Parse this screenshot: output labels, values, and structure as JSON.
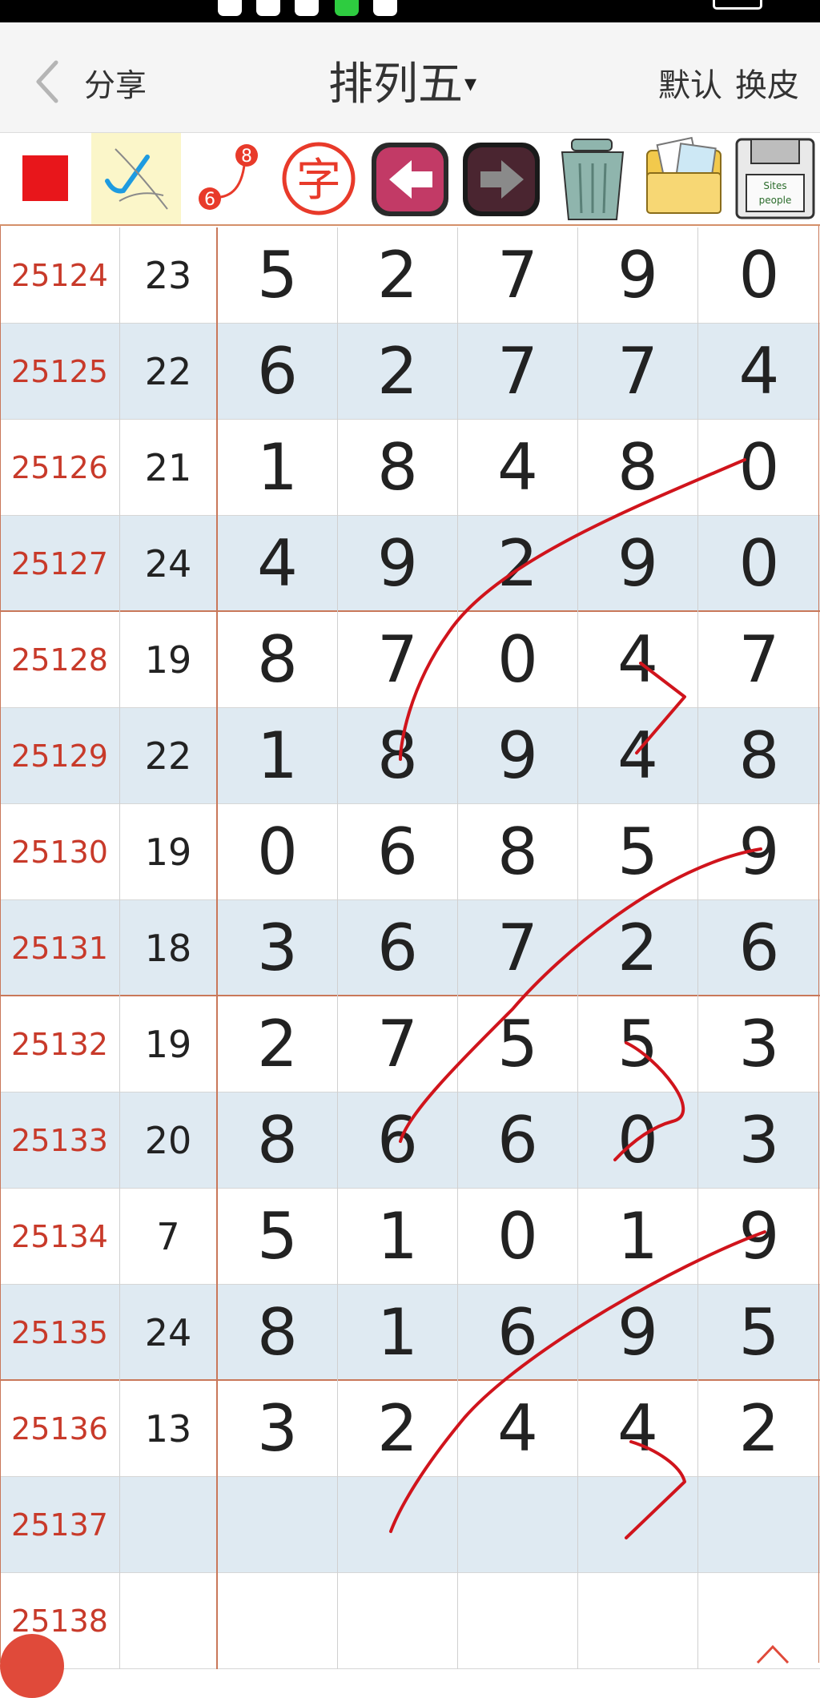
{
  "header": {
    "back_label": "分享",
    "title": "排列五",
    "title_caret": "▾",
    "default_label": "默认",
    "skin_label": "换皮"
  },
  "toolbar": {
    "tools": [
      {
        "name": "red-square-color-icon",
        "color": "#e8161b"
      },
      {
        "name": "check-pen-icon",
        "color": "#1e9be0"
      },
      {
        "name": "connect-numbers-icon",
        "badge_top": "8",
        "badge_bottom": "6"
      },
      {
        "name": "text-tool-icon",
        "label": "字"
      },
      {
        "name": "undo-arrow-icon"
      },
      {
        "name": "redo-arrow-icon"
      },
      {
        "name": "trash-icon"
      },
      {
        "name": "image-folder-icon"
      },
      {
        "name": "save-floppy-icon",
        "label_top": "Sites",
        "label_bottom": "people"
      }
    ]
  },
  "grid": {
    "rows": [
      {
        "issue": "25124",
        "sum": "23",
        "digits": [
          "5",
          "2",
          "7",
          "9",
          "0"
        ]
      },
      {
        "issue": "25125",
        "sum": "22",
        "digits": [
          "6",
          "2",
          "7",
          "7",
          "4"
        ]
      },
      {
        "issue": "25126",
        "sum": "21",
        "digits": [
          "1",
          "8",
          "4",
          "8",
          "0"
        ]
      },
      {
        "issue": "25127",
        "sum": "24",
        "digits": [
          "4",
          "9",
          "2",
          "9",
          "0"
        ]
      },
      {
        "issue": "25128",
        "sum": "19",
        "digits": [
          "8",
          "7",
          "0",
          "4",
          "7"
        ]
      },
      {
        "issue": "25129",
        "sum": "22",
        "digits": [
          "1",
          "8",
          "9",
          "4",
          "8"
        ]
      },
      {
        "issue": "25130",
        "sum": "19",
        "digits": [
          "0",
          "6",
          "8",
          "5",
          "9"
        ]
      },
      {
        "issue": "25131",
        "sum": "18",
        "digits": [
          "3",
          "6",
          "7",
          "2",
          "6"
        ]
      },
      {
        "issue": "25132",
        "sum": "19",
        "digits": [
          "2",
          "7",
          "5",
          "5",
          "3"
        ]
      },
      {
        "issue": "25133",
        "sum": "20",
        "digits": [
          "8",
          "6",
          "6",
          "0",
          "3"
        ]
      },
      {
        "issue": "25134",
        "sum": "7",
        "digits": [
          "5",
          "1",
          "0",
          "1",
          "9"
        ]
      },
      {
        "issue": "25135",
        "sum": "24",
        "digits": [
          "8",
          "1",
          "6",
          "9",
          "5"
        ]
      },
      {
        "issue": "25136",
        "sum": "13",
        "digits": [
          "3",
          "2",
          "4",
          "4",
          "2"
        ]
      },
      {
        "issue": "25137",
        "sum": "",
        "digits": [
          "",
          "",
          "",
          "",
          ""
        ]
      },
      {
        "issue": "25138",
        "sum": "",
        "digits": [
          "",
          "",
          "",
          "",
          ""
        ]
      }
    ]
  },
  "annotation": {
    "color": "#d0141c"
  }
}
